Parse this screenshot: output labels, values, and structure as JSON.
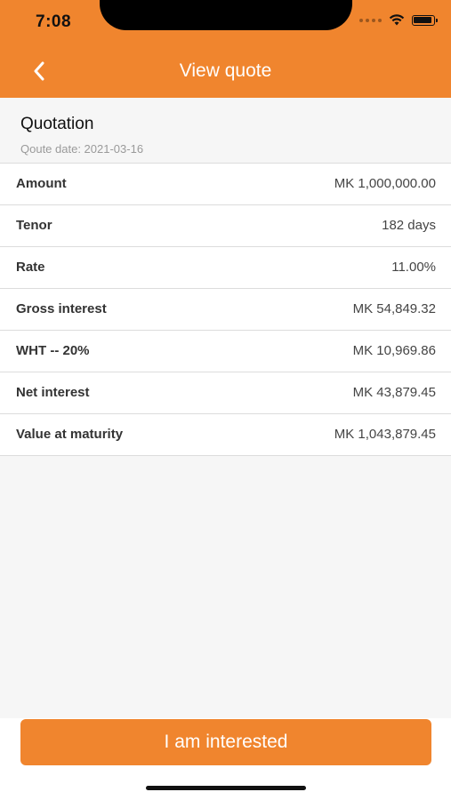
{
  "status_bar": {
    "time": "7:08"
  },
  "nav": {
    "back_icon": "chevron-left-icon",
    "title": "View quote"
  },
  "quotation": {
    "title": "Quotation",
    "date_text": "Qoute date: 2021-03-16"
  },
  "rows": [
    {
      "label": "Amount",
      "value": "MK 1,000,000.00"
    },
    {
      "label": "Tenor",
      "value": "182 days"
    },
    {
      "label": "Rate",
      "value": "11.00%"
    },
    {
      "label": "Gross interest",
      "value": "MK 54,849.32"
    },
    {
      "label": "WHT -- 20%",
      "value": "MK 10,969.86"
    },
    {
      "label": "Net interest",
      "value": "MK 43,879.45"
    },
    {
      "label": "Value at maturity",
      "value": "MK 1,043,879.45"
    }
  ],
  "cta": {
    "label": "I am interested"
  },
  "colors": {
    "accent": "#f0852e",
    "background": "#f6f6f6"
  }
}
